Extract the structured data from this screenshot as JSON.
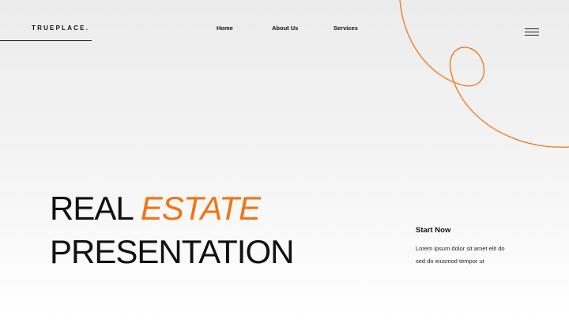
{
  "brand": {
    "logo": "TRUEPLACE.",
    "accent_color": "#f07416"
  },
  "nav": {
    "items": [
      "Home",
      "About Us",
      "Services"
    ],
    "menu_icon": "hamburger-menu-icon"
  },
  "hero": {
    "title_word_1": "REAL",
    "title_accent": "ESTATE",
    "title_line_2": "PRESENTATION"
  },
  "cta": {
    "heading": "Start Now",
    "text_line_1": "Lorem ipsum dolor sit amet elit do",
    "text_line_2": "sed do eiusmod tempor ut"
  }
}
